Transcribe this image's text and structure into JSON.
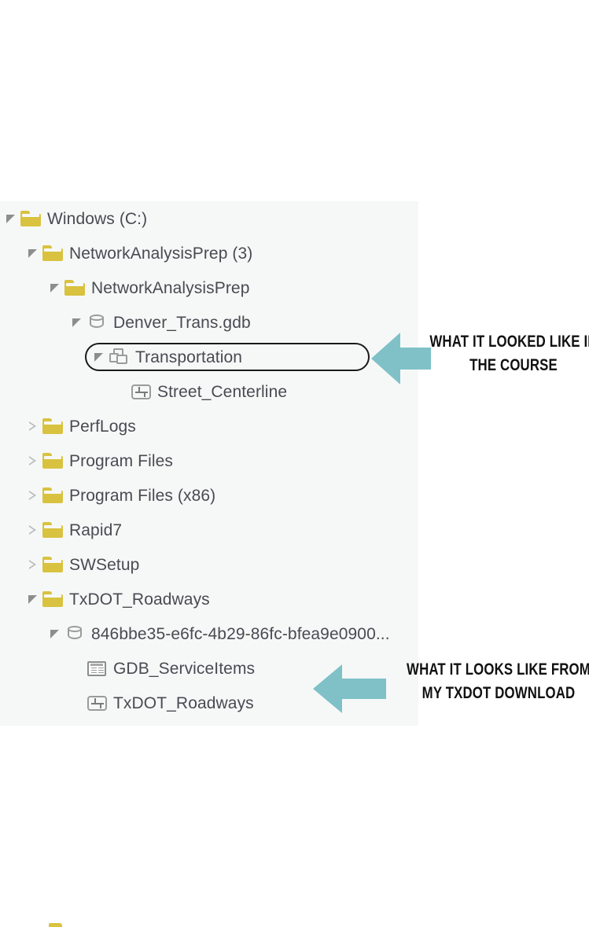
{
  "panel": {
    "name": "catalog-tree-panel",
    "background": "#f6f8f7"
  },
  "colors": {
    "folder": "#d9c23f",
    "tree_text": "#4a4a52",
    "arrow_teal": "#80c1c8",
    "selection_outline": "#1a1a1a",
    "annotation_text": "#111111",
    "panel_bg": "#f6f8f7",
    "page_bg": "#ffffff"
  },
  "tree": {
    "items": [
      {
        "label": "Windows (C:)",
        "icon": "folder-icon",
        "expander": "expanded",
        "depth": 0,
        "selected": false
      },
      {
        "label": "NetworkAnalysisPrep (3)",
        "icon": "folder-icon",
        "expander": "expanded",
        "depth": 1,
        "selected": false
      },
      {
        "label": "NetworkAnalysisPrep",
        "icon": "folder-icon",
        "expander": "expanded",
        "depth": 2,
        "selected": false
      },
      {
        "label": "Denver_Trans.gdb",
        "icon": "geodatabase-icon",
        "expander": "expanded",
        "depth": 3,
        "selected": false
      },
      {
        "label": "Transportation",
        "icon": "feature-dataset-icon",
        "expander": "expanded",
        "depth": 4,
        "selected": true
      },
      {
        "label": "Street_Centerline",
        "icon": "line-feature-class-icon",
        "expander": "none",
        "depth": 5,
        "selected": false
      },
      {
        "label": "PerfLogs",
        "icon": "folder-icon",
        "expander": "collapsed",
        "depth": 1,
        "selected": false
      },
      {
        "label": "Program Files",
        "icon": "folder-icon",
        "expander": "collapsed",
        "depth": 1,
        "selected": false
      },
      {
        "label": "Program Files (x86)",
        "icon": "folder-icon",
        "expander": "collapsed",
        "depth": 1,
        "selected": false
      },
      {
        "label": "Rapid7",
        "icon": "folder-icon",
        "expander": "collapsed",
        "depth": 1,
        "selected": false
      },
      {
        "label": "SWSetup",
        "icon": "folder-icon",
        "expander": "collapsed",
        "depth": 1,
        "selected": false
      },
      {
        "label": "TxDOT_Roadways",
        "icon": "folder-icon",
        "expander": "expanded",
        "depth": 1,
        "selected": false
      },
      {
        "label": "846bbe35-e6fc-4b29-86fc-bfea9e0900...",
        "icon": "geodatabase-icon",
        "expander": "expanded",
        "depth": 2,
        "selected": false
      },
      {
        "label": "GDB_ServiceItems",
        "icon": "table-icon",
        "expander": "none",
        "depth": 3,
        "selected": false
      },
      {
        "label": "TxDOT_Roadways",
        "icon": "line-feature-class-icon",
        "expander": "none",
        "depth": 3,
        "selected": false
      }
    ]
  },
  "annotations": [
    {
      "id": "course-callout",
      "text": "WHAT IT LOOKED LIKE IN\nTHE COURSE",
      "arrow_direction": "left"
    },
    {
      "id": "download-callout",
      "text": "WHAT IT LOOKS LIKE FROM\nMY TXDOT DOWNLOAD",
      "arrow_direction": "left"
    }
  ]
}
